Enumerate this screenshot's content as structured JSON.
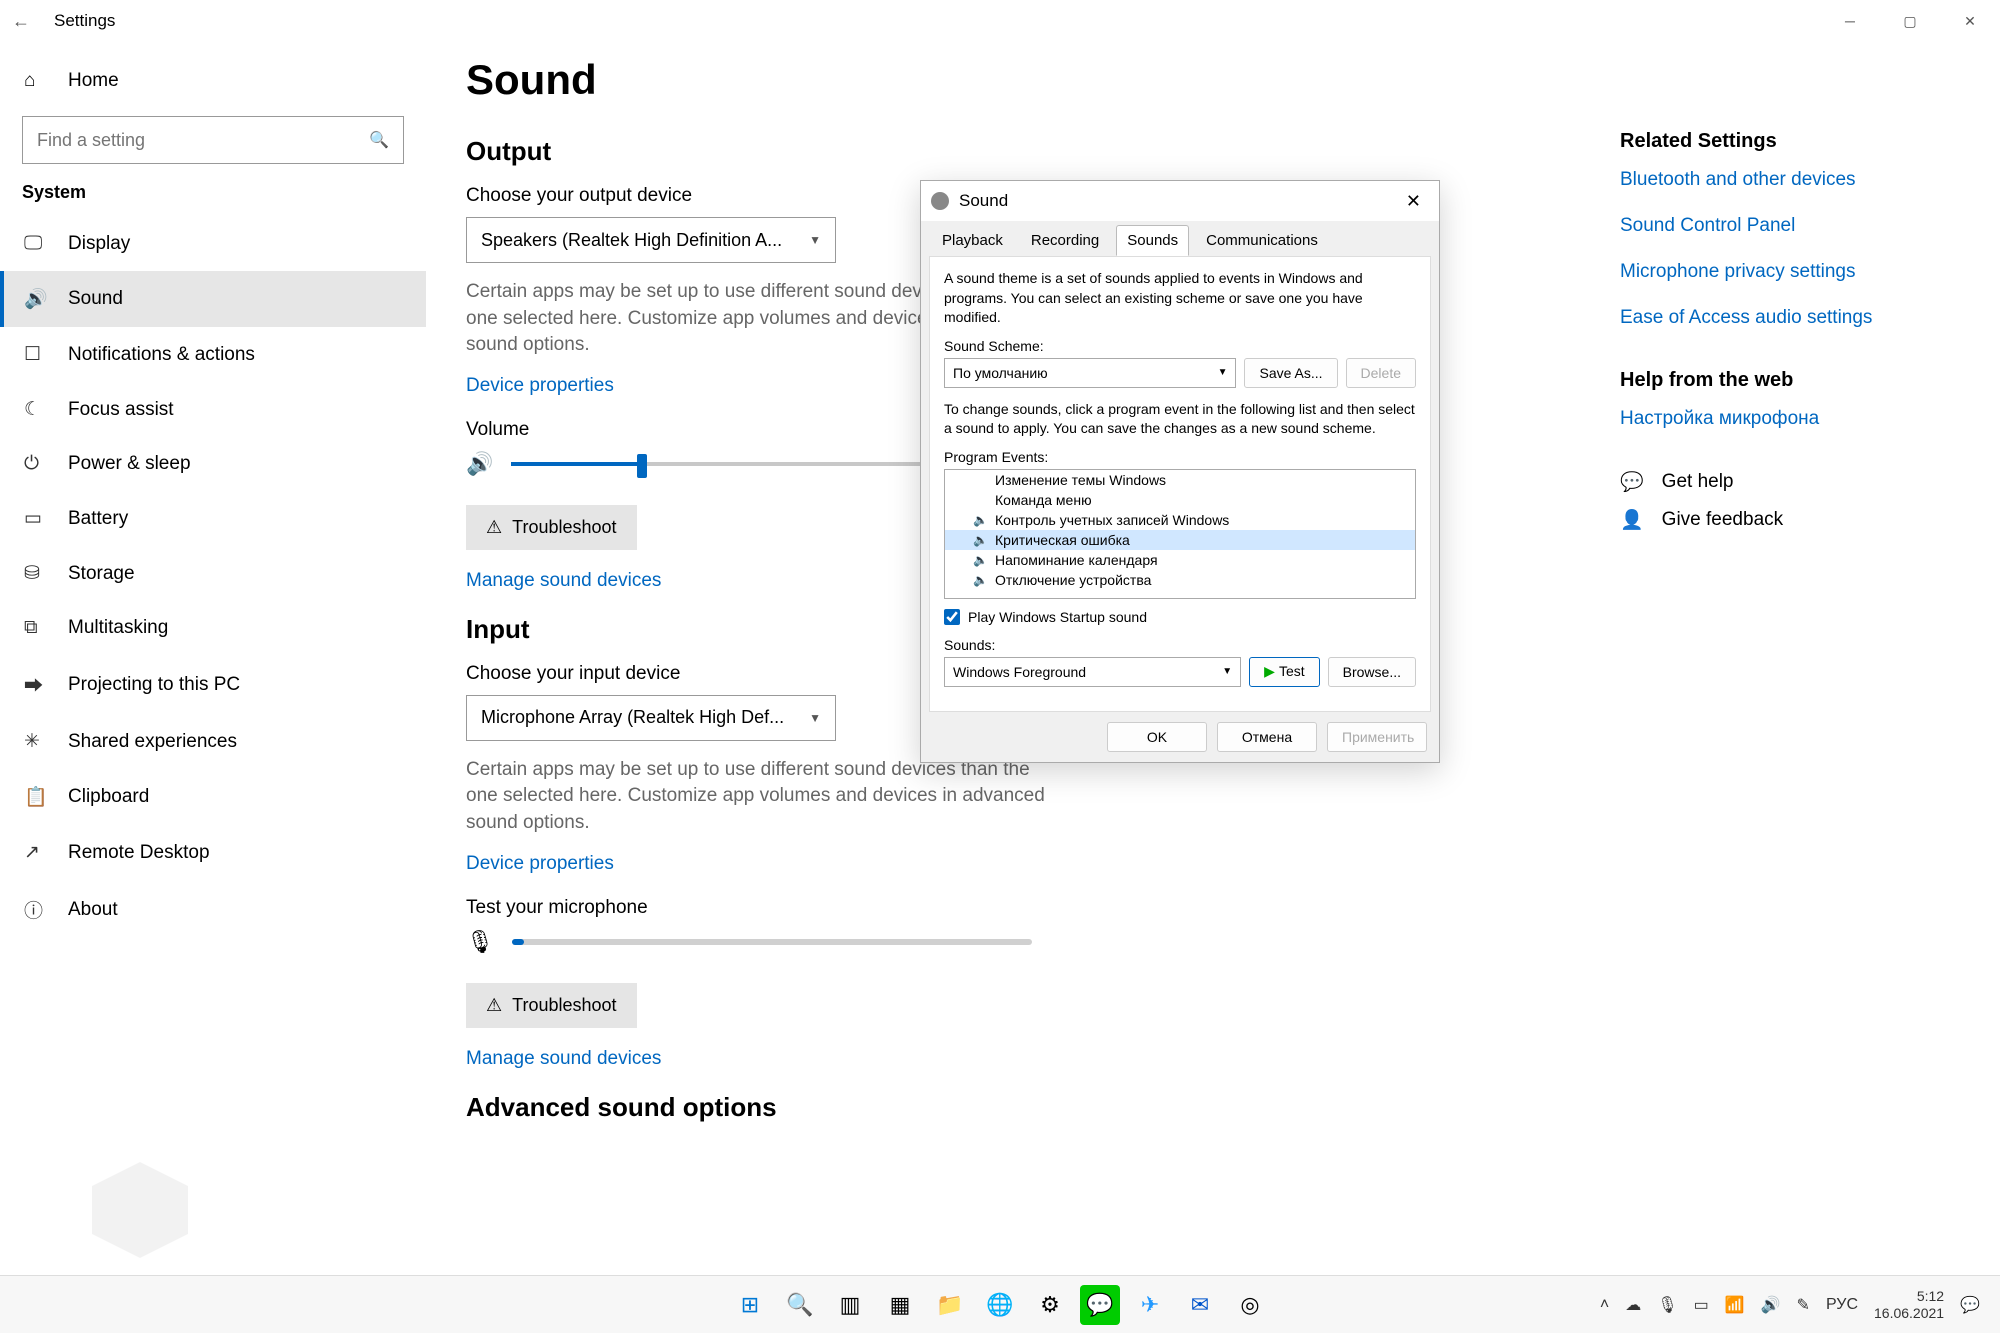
{
  "titlebar": {
    "title": "Settings"
  },
  "sidebar": {
    "home": "Home",
    "search_placeholder": "Find a setting",
    "section": "System",
    "items": [
      {
        "label": "Display"
      },
      {
        "label": "Sound"
      },
      {
        "label": "Notifications & actions"
      },
      {
        "label": "Focus assist"
      },
      {
        "label": "Power & sleep"
      },
      {
        "label": "Battery"
      },
      {
        "label": "Storage"
      },
      {
        "label": "Multitasking"
      },
      {
        "label": "Projecting to this PC"
      },
      {
        "label": "Shared experiences"
      },
      {
        "label": "Clipboard"
      },
      {
        "label": "Remote Desktop"
      },
      {
        "label": "About"
      }
    ]
  },
  "main": {
    "title": "Sound",
    "output": {
      "heading": "Output",
      "choose_label": "Choose your output device",
      "device": "Speakers (Realtek High Definition A...",
      "helptext": "Certain apps may be set up to use different sound devices than the one selected here. Customize app volumes and devices in advanced sound options.",
      "device_props": "Device properties",
      "volume_label": "Volume",
      "volume_percent": 30,
      "troubleshoot": "Troubleshoot",
      "manage": "Manage sound devices"
    },
    "input": {
      "heading": "Input",
      "choose_label": "Choose your input device",
      "device": "Microphone Array (Realtek High Def...",
      "helptext": "Certain apps may be set up to use different sound devices than the one selected here. Customize app volumes and devices in advanced sound options.",
      "device_props": "Device properties",
      "test_label": "Test your microphone",
      "troubleshoot": "Troubleshoot",
      "manage": "Manage sound devices"
    },
    "advanced": "Advanced sound options"
  },
  "right": {
    "related_heading": "Related Settings",
    "links": [
      "Bluetooth and other devices",
      "Sound Control Panel",
      "Microphone privacy settings",
      "Ease of Access audio settings"
    ],
    "web_heading": "Help from the web",
    "web_links": [
      "Настройка микрофона"
    ],
    "get_help": "Get help",
    "give_feedback": "Give feedback"
  },
  "dialog": {
    "title": "Sound",
    "tabs": [
      "Playback",
      "Recording",
      "Sounds",
      "Communications"
    ],
    "active_tab": 2,
    "intro": "A sound theme is a set of sounds applied to events in Windows and programs.  You can select an existing scheme or save one you have modified.",
    "scheme_label": "Sound Scheme:",
    "scheme_value": "По умолчанию",
    "save_as": "Save As...",
    "delete": "Delete",
    "change_text": "To change sounds, click a program event in the following list and then select a sound to apply.  You can save the changes as a new sound scheme.",
    "events_label": "Program Events:",
    "events": [
      {
        "label": "Изменение темы Windows",
        "has_sound": false
      },
      {
        "label": "Команда меню",
        "has_sound": false
      },
      {
        "label": "Контроль учетных записей Windows",
        "has_sound": true
      },
      {
        "label": "Критическая ошибка",
        "has_sound": true,
        "selected": true
      },
      {
        "label": "Напоминание календаря",
        "has_sound": true
      },
      {
        "label": "Отключение устройства",
        "has_sound": true
      }
    ],
    "startup_check": "Play Windows Startup sound",
    "sounds_label": "Sounds:",
    "sounds_value": "Windows Foreground",
    "test": "Test",
    "browse": "Browse...",
    "ok": "OK",
    "cancel": "Отмена",
    "apply": "Применить"
  },
  "taskbar": {
    "lang": "РУС",
    "time": "5:12",
    "date": "16.06.2021"
  }
}
